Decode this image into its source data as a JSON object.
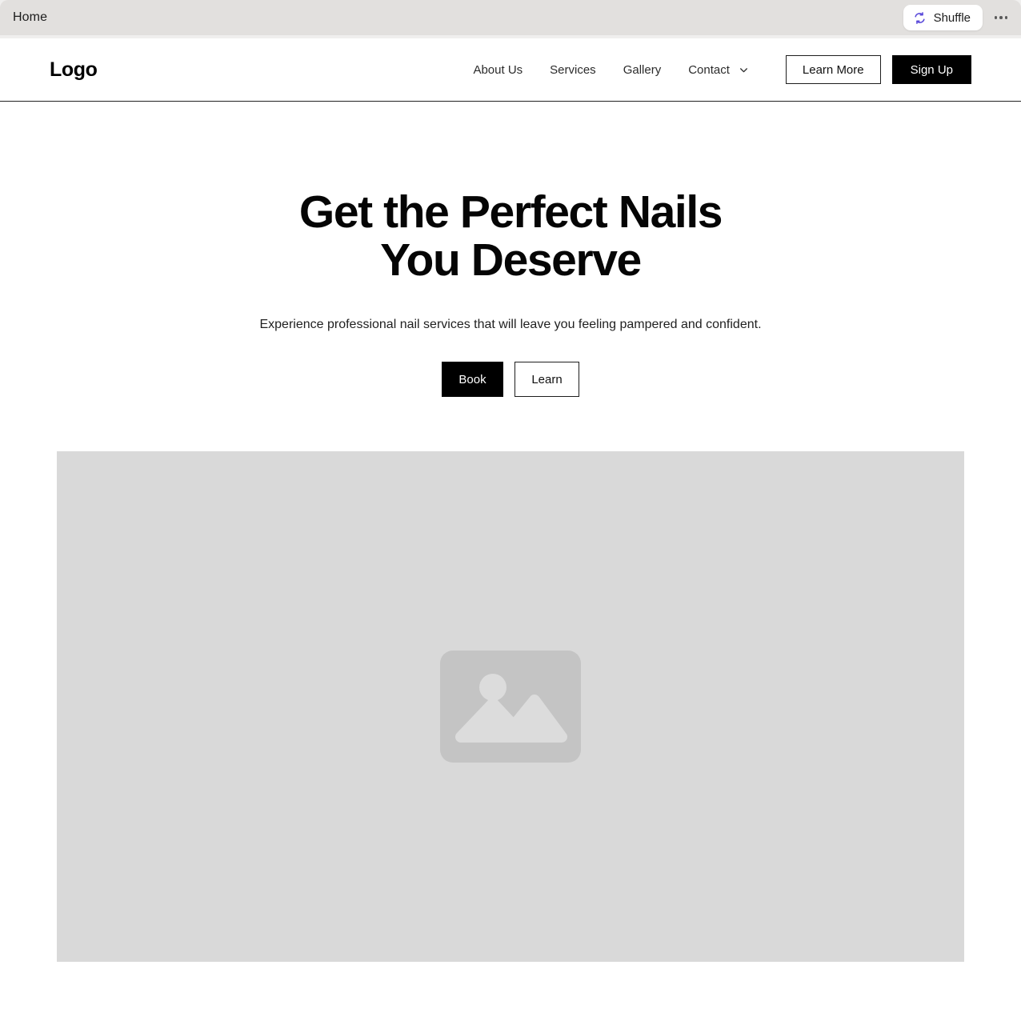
{
  "browser": {
    "tab_title": "Home",
    "shuffle_label": "Shuffle",
    "shuffle_icon": "shuffle-icon",
    "menu_icon": "kebab-menu-icon",
    "accent_color": "#5b4bda",
    "tab_bar_color": "#e2e0de"
  },
  "site": {
    "nav": {
      "brand": "Logo",
      "links": [
        {
          "label": "About Us"
        },
        {
          "label": "Services"
        },
        {
          "label": "Gallery"
        }
      ],
      "dropdown": {
        "label": "Contact",
        "icon": "chevron-down-icon"
      },
      "actions": {
        "secondary_label": "Learn More",
        "primary_label": "Sign Up"
      },
      "border_color": "#222222"
    },
    "hero": {
      "title": "Get the Perfect Nails You Deserve",
      "subtitle": "Experience professional nail services that will leave you feeling pampered and confident.",
      "primary_cta": "Book",
      "secondary_cta": "Learn",
      "media": {
        "icon": "image-placeholder-icon",
        "background_color": "#d9d9d9",
        "icon_color": "#c4c4c4"
      }
    }
  }
}
